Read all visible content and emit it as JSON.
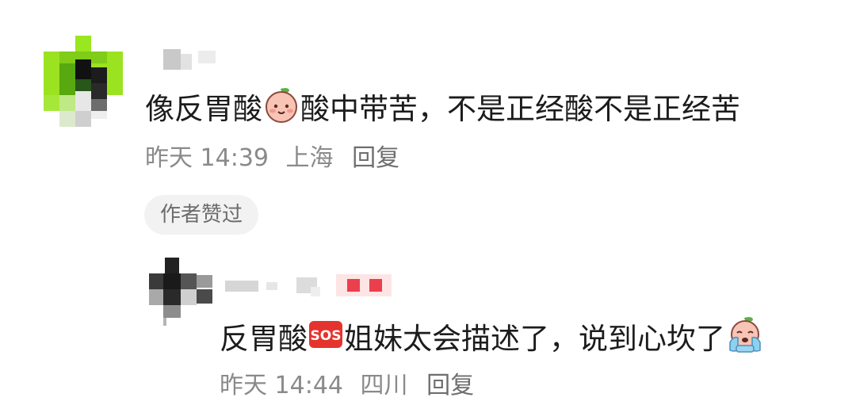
{
  "comment": {
    "text_part1": "像反胃酸",
    "text_part2": "酸中带苦，不是正经酸不是正经苦",
    "emoji": "peach-baby-face-emoji",
    "time": "昨天 14:39",
    "location": "上海",
    "reply_label": "回复",
    "badge": "作者赞过"
  },
  "reply": {
    "text_part1": "反胃酸",
    "text_part2": "姐妹太会描述了，说到心坎了",
    "sos_label": "SOS",
    "emoji_sos": "sos-emoji",
    "emoji_end": "crying-peach-emoji",
    "time": "昨天 14:44",
    "location": "四川",
    "reply_label": "回复"
  },
  "colors": {
    "meta_gray": "#8a8a8a",
    "badge_bg": "#f2f2f2",
    "sos_red": "#e5332d",
    "avatar_green": "#9ae61f",
    "peach_pink": "#f6b5a6"
  }
}
